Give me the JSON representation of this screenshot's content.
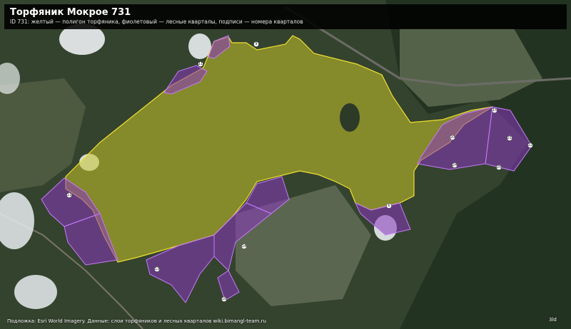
{
  "header": {
    "title": "Торфяник Мокрое 731",
    "subtitle": "ID 731: желтый — полигон торфяника, фиолетовый — лесные кварталы, подписи — номера кварталов"
  },
  "footer": {
    "attribution": "Подложка: Esri World Imagery. Данные: слои торфяников и лесных кварталов wiki.bimangl-team.ru",
    "corner_label": "3ld"
  },
  "legend_colors": {
    "peat_polygon": "#f0e030",
    "forest_quarters": "#9b3fd0"
  },
  "quarters": [
    {
      "id": "q-a",
      "label": "11"
    },
    {
      "id": "q-b",
      "label": "9"
    },
    {
      "id": "q-c",
      "label": "11"
    },
    {
      "id": "q-d",
      "label": "15"
    },
    {
      "id": "q-e",
      "label": "20"
    },
    {
      "id": "q-f",
      "label": "21"
    },
    {
      "id": "q-g",
      "label": "22"
    },
    {
      "id": "q-h",
      "label": "24"
    },
    {
      "id": "q-i",
      "label": "25"
    },
    {
      "id": "q-j",
      "label": "13"
    },
    {
      "id": "q-k",
      "label": "14"
    },
    {
      "id": "q-l",
      "label": "18"
    },
    {
      "id": "q-m",
      "label": "6"
    }
  ]
}
